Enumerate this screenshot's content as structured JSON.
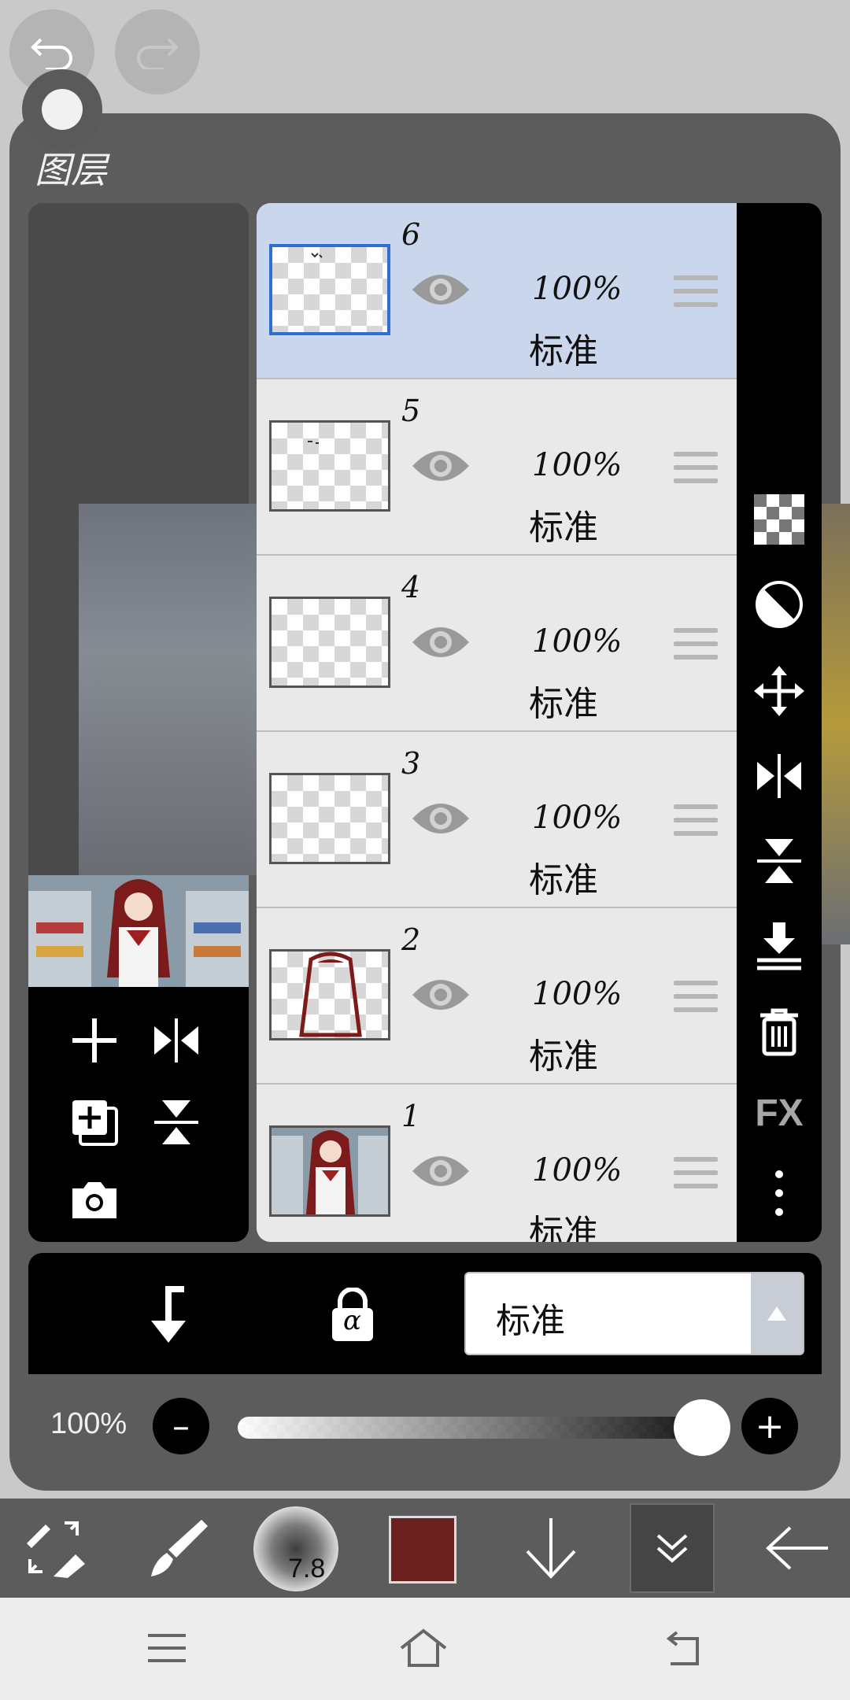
{
  "panel": {
    "title": "图层"
  },
  "layers": [
    {
      "number": "6",
      "opacity": "100%",
      "blend": "标准",
      "selected": true
    },
    {
      "number": "5",
      "opacity": "100%",
      "blend": "标准",
      "selected": false
    },
    {
      "number": "4",
      "opacity": "100%",
      "blend": "标准",
      "selected": false
    },
    {
      "number": "3",
      "opacity": "100%",
      "blend": "标准",
      "selected": false
    },
    {
      "number": "2",
      "opacity": "100%",
      "blend": "标准",
      "selected": false
    },
    {
      "number": "1",
      "opacity": "100%",
      "blend": "标准",
      "selected": false
    }
  ],
  "side_tools": {
    "fx_label": "FX"
  },
  "blend_bar": {
    "blend_mode": "标准",
    "alpha_lock_label": "α"
  },
  "opacity_bar": {
    "value_label": "100%",
    "value": 1.0
  },
  "bottom_toolbar": {
    "brush_size": "7.8",
    "color": "#6b1f1f"
  },
  "colors": {
    "selected_row": "#c9d6eb",
    "panel": "#5c5c5c",
    "selection_border": "#2f6fd1"
  }
}
